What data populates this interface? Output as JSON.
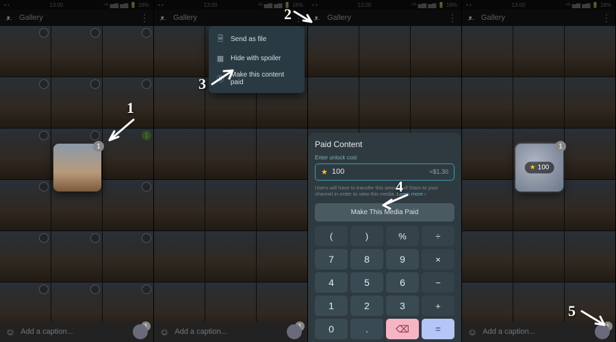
{
  "status": {
    "time": "13:00",
    "right": "⁴ᴳ ▅▆ ▅▆ 🔋 18%"
  },
  "topbar": {
    "title": "Gallery"
  },
  "caption_placeholder": "Add a caption...",
  "selected_count": "1",
  "menu": {
    "send_as_file": "Send as file",
    "hide_with_spoiler": "Hide with spoiler",
    "make_paid": "Make this content paid"
  },
  "paid": {
    "title": "Paid Content",
    "sub": "Enter unlock cost",
    "value": "100",
    "approx": "≈$1.30",
    "hint_a": "Users will have to transfer this amount of Stars to your channel in order to view this media. ",
    "hint_link": "Learn more ›",
    "button": "Make This Media Paid"
  },
  "keys": [
    "(",
    ")",
    "%",
    "÷",
    "7",
    "8",
    "9",
    "×",
    "4",
    "5",
    "6",
    "−",
    "1",
    "2",
    "3",
    "+",
    "0",
    ".",
    "⌫",
    "="
  ],
  "star_label": "100",
  "anno": {
    "n1": "1",
    "n2": "2",
    "n3": "3",
    "n4": "4",
    "n5": "5"
  }
}
